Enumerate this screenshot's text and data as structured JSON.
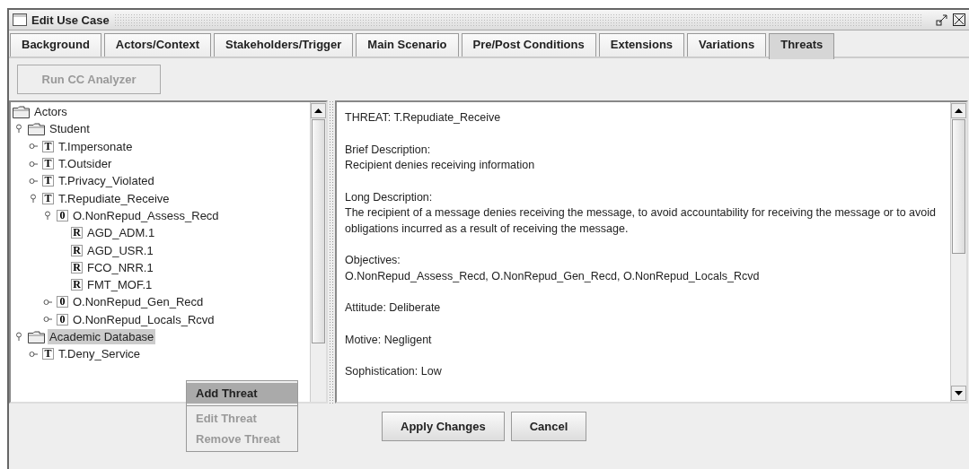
{
  "window": {
    "title": "Edit Use Case"
  },
  "tabs": [
    {
      "label": "Background",
      "selected": false
    },
    {
      "label": "Actors/Context",
      "selected": false
    },
    {
      "label": "Stakeholders/Trigger",
      "selected": false
    },
    {
      "label": "Main Scenario",
      "selected": false
    },
    {
      "label": "Pre/Post Conditions",
      "selected": false
    },
    {
      "label": "Extensions",
      "selected": false
    },
    {
      "label": "Variations",
      "selected": false
    },
    {
      "label": "Threats",
      "selected": true
    }
  ],
  "toolbar": {
    "button": {
      "label": "Run CC Analyzer",
      "disabled": true
    }
  },
  "tree": [
    {
      "label": "Actors",
      "kind": "folder",
      "selected": false
    },
    {
      "label": "Student",
      "kind": "folder",
      "expanded": true,
      "selected": false,
      "children": [
        {
          "label": "T.Impersonate",
          "kind": "threat",
          "badge": "T",
          "expanded": false,
          "selected": false
        },
        {
          "label": "T.Outsider",
          "kind": "threat",
          "badge": "T",
          "expanded": false,
          "selected": false
        },
        {
          "label": "T.Privacy_Violated",
          "kind": "threat",
          "badge": "T",
          "expanded": false,
          "selected": false
        },
        {
          "label": "T.Repudiate_Receive",
          "kind": "threat",
          "badge": "T",
          "expanded": true,
          "selected": false,
          "children": [
            {
              "label": "O.NonRepud_Assess_Recd",
              "kind": "objective",
              "badge": "0",
              "expanded": true,
              "selected": false,
              "children": [
                {
                  "label": "AGD_ADM.1",
                  "kind": "requirement",
                  "badge": "R",
                  "selected": false
                },
                {
                  "label": "AGD_USR.1",
                  "kind": "requirement",
                  "badge": "R",
                  "selected": false
                },
                {
                  "label": "FCO_NRR.1",
                  "kind": "requirement",
                  "badge": "R",
                  "selected": false
                },
                {
                  "label": "FMT_MOF.1",
                  "kind": "requirement",
                  "badge": "R",
                  "selected": false
                }
              ]
            },
            {
              "label": "O.NonRepud_Gen_Recd",
              "kind": "objective",
              "badge": "0",
              "expanded": false,
              "selected": false
            },
            {
              "label": "O.NonRepud_Locals_Rcvd",
              "kind": "objective",
              "badge": "0",
              "expanded": false,
              "selected": false
            }
          ]
        }
      ]
    },
    {
      "label": "Academic Database",
      "kind": "folder",
      "expanded": true,
      "selected": true,
      "children": [
        {
          "label": "T.Deny_Service",
          "kind": "threat",
          "badge": "T",
          "expanded": false,
          "selected": false
        }
      ]
    }
  ],
  "context_menu": [
    {
      "label": "Add Threat",
      "selected": true,
      "disabled": false
    },
    {
      "label": "Edit Threat",
      "selected": false,
      "disabled": true
    },
    {
      "label": "Remove Threat",
      "selected": false,
      "disabled": true
    }
  ],
  "details": [
    {
      "lines": [
        "THREAT: T.Repudiate_Receive"
      ]
    },
    {
      "lines": [
        "Brief Description:",
        "Recipient denies receiving information"
      ]
    },
    {
      "lines": [
        "Long Description:",
        "The recipient of a message denies receiving the message, to avoid accountability for receiving the message or to avoid obligations incurred as a result of receiving the message."
      ]
    },
    {
      "lines": [
        "Objectives:",
        "O.NonRepud_Assess_Recd, O.NonRepud_Gen_Recd, O.NonRepud_Locals_Rcvd"
      ]
    },
    {
      "lines": [
        "Attitude: Deliberate"
      ]
    },
    {
      "lines": [
        "Motive: Negligent"
      ]
    },
    {
      "lines": [
        "Sophistication: Low"
      ]
    }
  ],
  "buttons": [
    {
      "label": "Apply Changes"
    },
    {
      "label": "Cancel"
    }
  ]
}
